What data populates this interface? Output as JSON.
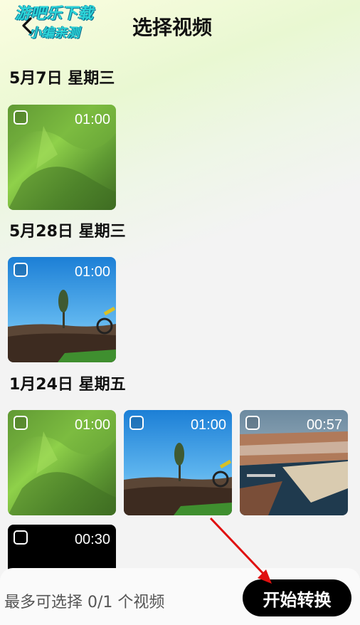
{
  "header": {
    "title": "选择视频",
    "watermark_line1": "游吧乐下载",
    "watermark_line2": "小编亲测"
  },
  "sections": [
    {
      "date": "5月7日 星期三",
      "videos": [
        {
          "duration": "01:00",
          "scene": "grass"
        }
      ]
    },
    {
      "date": "5月28日 星期三",
      "videos": [
        {
          "duration": "01:00",
          "scene": "sky-tree"
        }
      ]
    },
    {
      "date": "1月24日 星期五",
      "videos": [
        {
          "duration": "01:00",
          "scene": "grass"
        },
        {
          "duration": "01:00",
          "scene": "sky-tree"
        },
        {
          "duration": "00:57",
          "scene": "harbor"
        },
        {
          "duration": "00:30",
          "scene": "black"
        }
      ]
    }
  ],
  "footer": {
    "limit_text": "最多可选择 0/1 个视频",
    "start_label": "开始转换"
  },
  "colors": {
    "accent_arrow": "#e01010",
    "button_bg": "#000000"
  }
}
